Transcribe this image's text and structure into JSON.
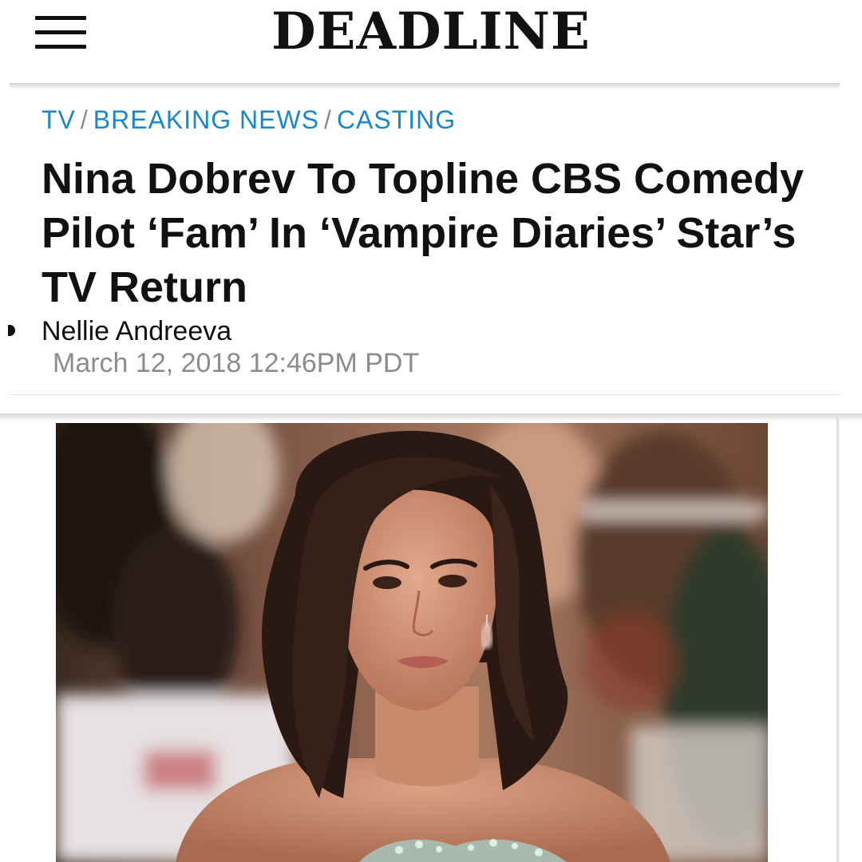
{
  "header": {
    "logo": "DEADLINE",
    "menu_icon": "hamburger-menu-icon"
  },
  "breadcrumb": {
    "items": [
      "TV",
      "BREAKING NEWS",
      "CASTING"
    ],
    "separator": "/",
    "color": "#1b86c9"
  },
  "article": {
    "headline": "Nina Dobrev To Topline CBS Comedy Pilot ‘Fam’ In ‘Vampire Diaries’ Star’s TV Return",
    "author": "Nellie Andreeva",
    "date": "March 12, 2018 12:46PM PDT",
    "image": {
      "subject": "woman-portrait-photo",
      "background": "red-carpet-event-photo"
    }
  }
}
